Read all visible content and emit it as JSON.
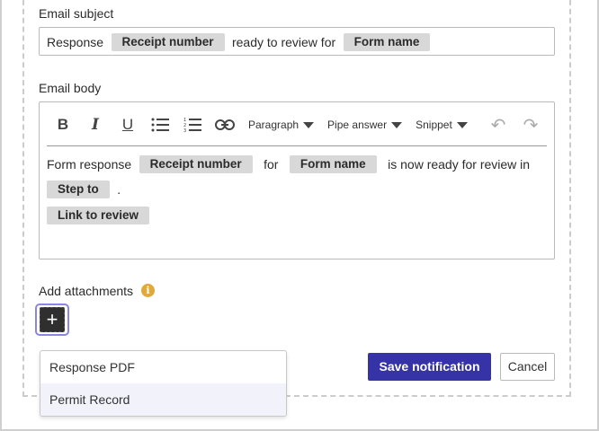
{
  "email_subject": {
    "label": "Email subject",
    "text_before": "Response",
    "chip1": "Receipt number",
    "text_middle": "ready to review for",
    "chip2": "Form name"
  },
  "email_body": {
    "label": "Email body",
    "toolbar": {
      "bold": "B",
      "italic": "I",
      "underline": "U",
      "bullet_list": "☰",
      "numbered_list": "☷",
      "link": "🔗",
      "paragraph": "Paragraph",
      "pipe_answer": "Pipe answer",
      "snippet": "Snippet",
      "undo": "↶",
      "redo": "↷"
    },
    "line1_text1": "Form response",
    "line1_chip1": "Receipt number",
    "line1_text2": "for",
    "line1_chip2": "Form name",
    "line1_text3": "is now ready for review in",
    "line2_chip": "Step to",
    "line2_text": ".",
    "line3_chip": "Link to review"
  },
  "attachments": {
    "label": "Add attachments",
    "info": "i",
    "add": "+"
  },
  "dropdown": {
    "items": [
      "Response PDF",
      "Permit Record"
    ]
  },
  "actions": {
    "save": "Save notification",
    "cancel": "Cancel"
  },
  "colors": {
    "primary": "#3533a6",
    "focus_ring": "#8b86e6",
    "info": "#e0a93a",
    "chip": "#d8d8d8"
  }
}
